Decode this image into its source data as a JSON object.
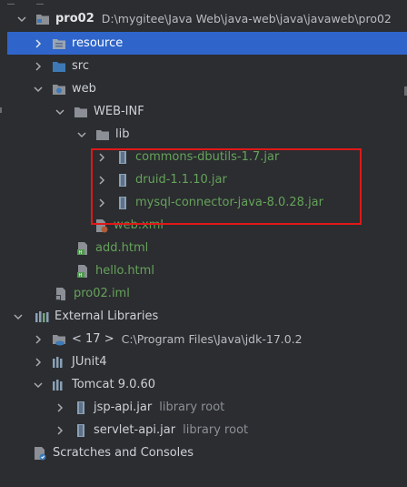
{
  "project": {
    "name": "pro02",
    "path": "D:\\mygitee\\Java Web\\java-web\\java\\javaweb\\pro02"
  },
  "tree": {
    "resource": "resource",
    "src": "src",
    "web": "web",
    "web_inf": "WEB-INF",
    "lib": "lib",
    "jars": [
      "commons-dbutils-1.7.jar",
      "druid-1.1.10.jar",
      "mysql-connector-java-8.0.28.jar"
    ],
    "web_xml": "web.xml",
    "add_html": "add.html",
    "hello_html": "hello.html",
    "iml": "pro02.iml",
    "external_libraries": "External Libraries",
    "jdk": {
      "label": "< 17 >",
      "path": "C:\\Program Files\\Java\\jdk-17.0.2"
    },
    "junit": "JUnit4",
    "tomcat": "Tomcat 9.0.60",
    "jsp_api": {
      "label": "jsp-api.jar",
      "hint": "library root"
    },
    "servlet_api": {
      "label": "servlet-api.jar",
      "hint": "library root"
    },
    "scratches": "Scratches and Consoles"
  },
  "icons": {
    "folder": "folder-icon",
    "jar": "jar-icon",
    "module": "module-icon",
    "html": "html-file-icon",
    "xml": "xml-file-icon",
    "libraries": "libraries-icon",
    "jdk": "jdk-icon",
    "scratches": "scratches-icon"
  },
  "colors": {
    "selection": "#2f65ca",
    "highlight_box": "#e01818",
    "jar_text": "#66a25a",
    "background": "#2b2d30"
  }
}
